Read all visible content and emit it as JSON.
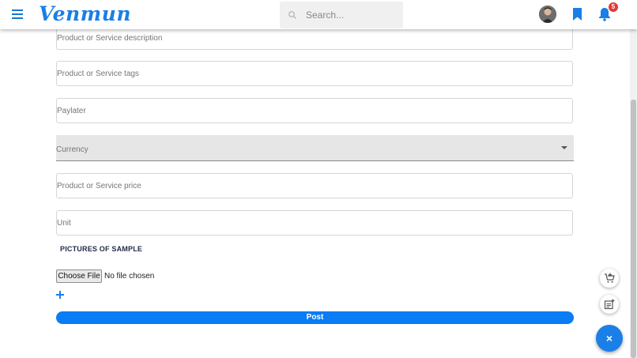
{
  "header": {
    "brand": "Venmun",
    "search_placeholder": "Search...",
    "notification_count": "5",
    "accent_color": "#1a7fe6"
  },
  "form": {
    "fields": [
      {
        "label": "Product or Service description"
      },
      {
        "label": "Product or Service tags"
      },
      {
        "label": "Paylater"
      },
      {
        "label": "Currency"
      },
      {
        "label": "Product or Service price"
      },
      {
        "label": "Unit"
      }
    ],
    "pictures_title": "PICTURES OF SAMPLE",
    "file_button": "Choose File",
    "file_status": "No file chosen",
    "post_label": "Post"
  },
  "icons": {
    "menu": "menu-icon",
    "search": "search-icon",
    "bookmark": "bookmark-icon",
    "bell": "bell-icon",
    "plus": "plus-icon",
    "cart": "cart-add-icon",
    "post_add": "post-add-icon",
    "close": "close-icon"
  },
  "fab": {
    "close_label": "×"
  }
}
